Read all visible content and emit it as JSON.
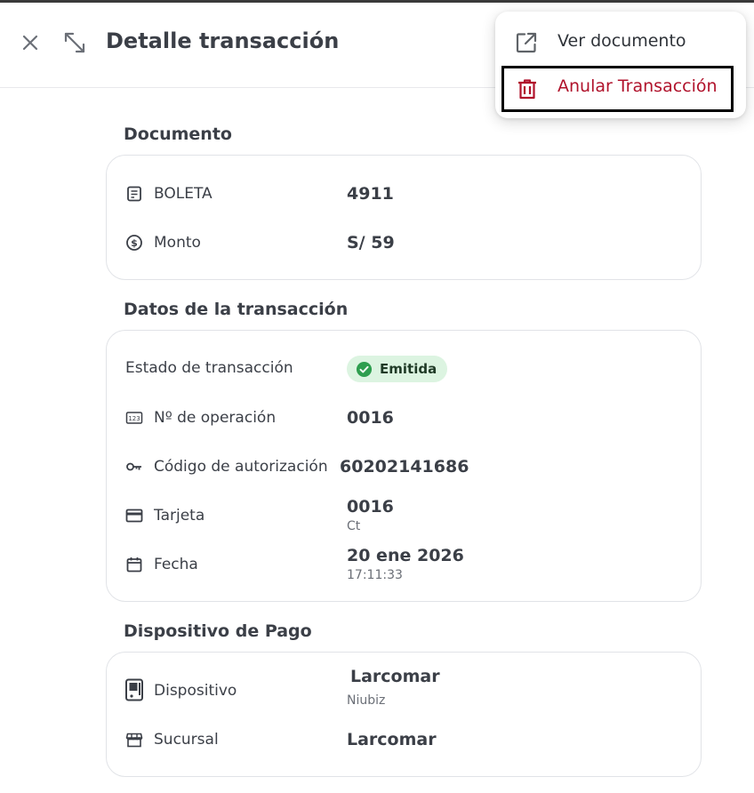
{
  "header": {
    "title": "Detalle transacción",
    "close_icon": "close-icon",
    "expand_icon": "expand-diagonal-icon"
  },
  "menu": {
    "items": [
      {
        "label": "Ver documento",
        "icon": "open-in-new-icon"
      },
      {
        "label": "Anular Transacción",
        "icon": "trash-icon",
        "color": "#b0122b"
      }
    ]
  },
  "documento": {
    "title": "Documento",
    "rows": [
      {
        "label": "BOLETA",
        "value": "4911",
        "icon": "receipt-icon"
      },
      {
        "label": "Monto",
        "value": "S/ 59",
        "icon": "dollar-circle-icon"
      }
    ]
  },
  "transaccion": {
    "title": "Datos de la transacción",
    "estado_label": "Estado de transacción",
    "estado_badge": "Emitida",
    "badge_color": "#dcf4e1",
    "rows": [
      {
        "label": "Nº de operación",
        "value": "0016",
        "icon": "numeric-123-icon"
      },
      {
        "label": "Código de autorización",
        "value": "60202141686",
        "icon": "key-icon"
      },
      {
        "label": "Tarjeta",
        "value": "0016",
        "sub": "Ct",
        "icon": "credit-card-icon"
      },
      {
        "label": "Fecha",
        "value": "20 ene 2026",
        "sub": "17:11:33",
        "icon": "calendar-icon"
      }
    ]
  },
  "dispositivo": {
    "title": "Dispositivo de Pago",
    "rows": [
      {
        "label": "Dispositivo",
        "value": "Larcomar",
        "sub": "Niubiz",
        "icon": "pos-terminal-icon"
      },
      {
        "label": "Sucursal",
        "value": "Larcomar",
        "icon": "store-icon"
      }
    ]
  }
}
